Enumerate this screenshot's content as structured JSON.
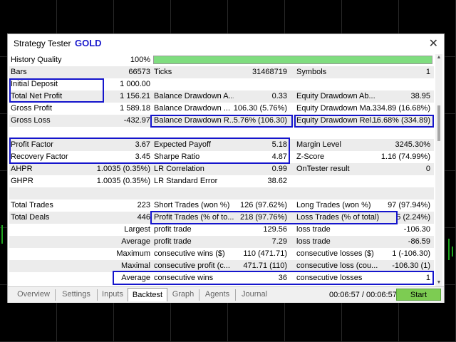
{
  "window": {
    "title": "Strategy Tester",
    "symbol": "GOLD",
    "close_icon": "close-icon"
  },
  "progress": {
    "fraction": 1.0
  },
  "stats": {
    "history_quality": {
      "label": "History Quality",
      "value": "100%"
    },
    "bars": {
      "label": "Bars",
      "value": "66573"
    },
    "ticks": {
      "label": "Ticks",
      "value": "31468719"
    },
    "symbols": {
      "label": "Symbols",
      "value": "1"
    },
    "initial_deposit": {
      "label": "Initial Deposit",
      "value": "1 000.00"
    },
    "total_net_profit": {
      "label": "Total Net Profit",
      "value": "1 156.21"
    },
    "bal_dd_abs": {
      "label": "Balance Drawdown A...",
      "value": "0.33"
    },
    "eq_dd_abs": {
      "label": "Equity Drawdown Ab...",
      "value": "38.95"
    },
    "gross_profit": {
      "label": "Gross Profit",
      "value": "1 589.18"
    },
    "bal_dd_max": {
      "label": "Balance Drawdown ...",
      "value": "106.30 (5.76%)"
    },
    "eq_dd_max": {
      "label": "Equity Drawdown Ma...",
      "value": "334.89 (16.68%)"
    },
    "gross_loss": {
      "label": "Gross Loss",
      "value": "-432.97"
    },
    "bal_dd_rel": {
      "label": "Balance Drawdown R...",
      "value": "5.76% (106.30)"
    },
    "eq_dd_rel": {
      "label": "Equity Drawdown Rel...",
      "value": "16.68% (334.89)"
    },
    "profit_factor": {
      "label": "Profit Factor",
      "value": "3.67"
    },
    "expected_payoff": {
      "label": "Expected Payoff",
      "value": "5.18"
    },
    "margin_level": {
      "label": "Margin Level",
      "value": "3245.30%"
    },
    "recovery_factor": {
      "label": "Recovery Factor",
      "value": "3.45"
    },
    "sharpe_ratio": {
      "label": "Sharpe Ratio",
      "value": "4.87"
    },
    "z_score": {
      "label": "Z-Score",
      "value": "1.16 (74.99%)"
    },
    "ahpr": {
      "label": "AHPR",
      "value": "1.0035 (0.35%)"
    },
    "lr_correlation": {
      "label": "LR Correlation",
      "value": "0.99"
    },
    "ontester_result": {
      "label": "OnTester result",
      "value": "0"
    },
    "ghpr": {
      "label": "GHPR",
      "value": "1.0035 (0.35%)"
    },
    "lr_std_error": {
      "label": "LR Standard Error",
      "value": "38.62"
    },
    "total_trades": {
      "label": "Total Trades",
      "value": "223"
    },
    "short_trades": {
      "label": "Short Trades (won %)",
      "value": "126 (97.62%)"
    },
    "long_trades": {
      "label": "Long Trades (won %)",
      "value": "97 (97.94%)"
    },
    "total_deals": {
      "label": "Total Deals",
      "value": "446"
    },
    "profit_trades": {
      "label": "Profit Trades (% of to...",
      "value": "218 (97.76%)"
    },
    "loss_trades": {
      "label": "Loss Trades (% of total)",
      "value": "5 (2.24%)"
    },
    "largest": {
      "label": "Largest",
      "l2": "profit trade",
      "v2": "129.56",
      "l3": "loss trade",
      "v3": "-106.30"
    },
    "average": {
      "label": "Average",
      "l2": "profit trade",
      "v2": "7.29",
      "l3": "loss trade",
      "v3": "-86.59"
    },
    "maximum": {
      "label": "Maximum",
      "l2": "consecutive wins ($)",
      "v2": "110 (471.71)",
      "l3": "consecutive losses ($)",
      "v3": "1 (-106.30)"
    },
    "maximal": {
      "label": "Maximal",
      "l2": "consecutive profit (c...",
      "v2": "471.71 (110)",
      "l3": "consecutive loss (cou...",
      "v3": "-106.30 (1)"
    },
    "average_cons": {
      "label": "Average",
      "l2": "consecutive wins",
      "v2": "36",
      "l3": "consecutive losses",
      "v3": "1"
    }
  },
  "tabs": [
    {
      "label": "Overview"
    },
    {
      "label": "Settings"
    },
    {
      "label": "Inputs"
    },
    {
      "label": "Backtest",
      "active": true
    },
    {
      "label": "Graph"
    },
    {
      "label": "Agents"
    },
    {
      "label": "Journal"
    }
  ],
  "timer": "00:06:57 / 00:06:57",
  "start_label": "Start",
  "colors": {
    "highlight": "#1515cc",
    "start_button": "#7dcc52",
    "progress": "#7fdd7f",
    "symbol": "#1a1acc"
  }
}
